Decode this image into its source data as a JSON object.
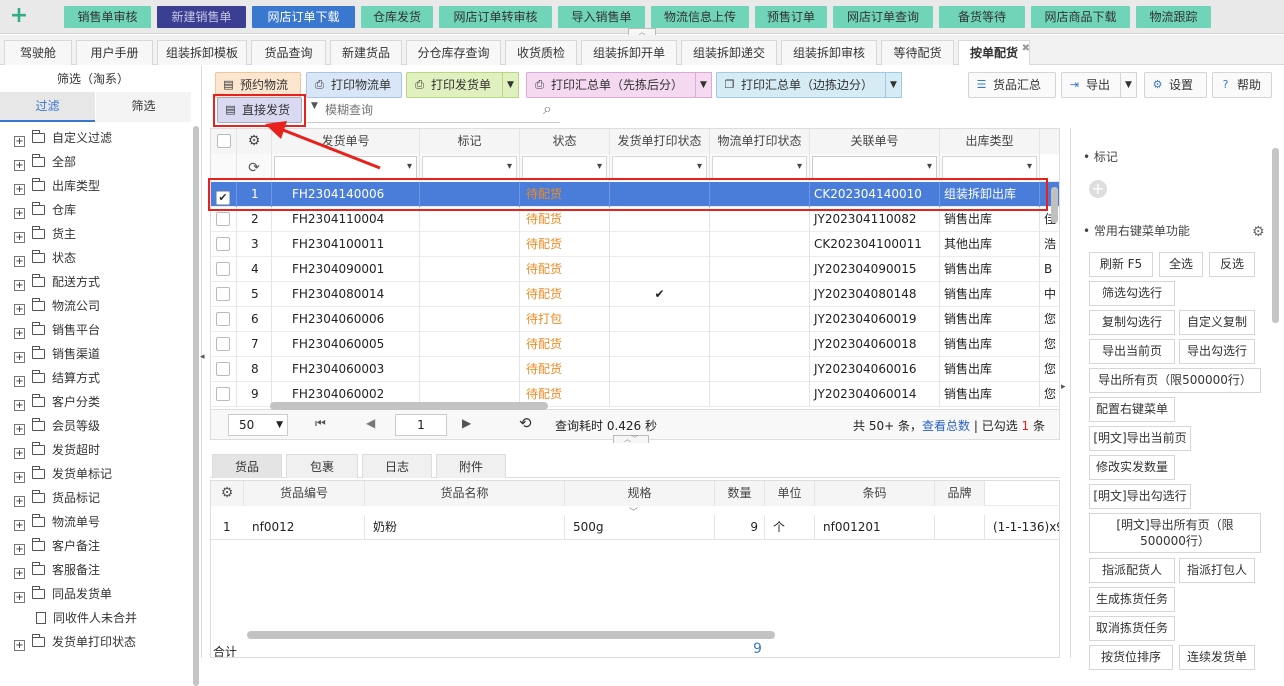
{
  "top_modules": [
    {
      "label": "销售单审核",
      "state": "normal"
    },
    {
      "label": "新建销售单",
      "state": "active"
    },
    {
      "label": "网店订单下载",
      "state": "current"
    },
    {
      "label": "仓库发货",
      "state": "normal"
    },
    {
      "label": "网店订单转审核",
      "state": "normal"
    },
    {
      "label": "导入销售单",
      "state": "normal"
    },
    {
      "label": "物流信息上传",
      "state": "normal"
    },
    {
      "label": "预售订单",
      "state": "normal"
    },
    {
      "label": "网店订单查询",
      "state": "normal"
    },
    {
      "label": "备货等待",
      "state": "normal"
    },
    {
      "label": "网店商品下载",
      "state": "normal"
    },
    {
      "label": "物流跟踪",
      "state": "normal"
    }
  ],
  "tabs": [
    "驾驶舱",
    "用户手册",
    "组装拆卸模板",
    "货品查询",
    "新建货品",
    "分仓库存查询",
    "收货质检",
    "组装拆卸开单",
    "组装拆卸递交",
    "组装拆卸审核",
    "等待配货",
    "按单配货"
  ],
  "sidebar": {
    "title": "筛选（淘系）",
    "tab_filter": "过滤",
    "tab_screen": "筛选",
    "items": [
      "自定义过滤",
      "全部",
      "出库类型",
      "仓库",
      "货主",
      "状态",
      "配送方式",
      "物流公司",
      "销售平台",
      "销售渠道",
      "结算方式",
      "客户分类",
      "会员等级",
      "发货超时",
      "发货单标记",
      "货品标记",
      "物流单号",
      "客户备注",
      "客服备注",
      "同品发货单",
      "同收件人未合并",
      "发货单打印状态"
    ]
  },
  "toolbar": {
    "reserve_logistics": "预约物流",
    "print_logistics": "打印物流单",
    "print_delivery": "打印发货单",
    "print_summary_pick_first": "打印汇总单（先拣后分）",
    "print_summary_pick_while": "打印汇总单（边拣边分）",
    "direct_ship": "直接发货",
    "goods_summary": "货品汇总",
    "export": "导出",
    "settings": "设置",
    "help": "帮助",
    "search_placeholder": "模糊查询"
  },
  "main_table": {
    "columns": [
      "发货单号",
      "标记",
      "状态",
      "发货单打印状态",
      "物流单打印状态",
      "关联单号",
      "出库类型"
    ],
    "rows": [
      {
        "no": "1",
        "order": "FH2304140006",
        "mark": "",
        "status": "待配货",
        "print": "",
        "lprint": "",
        "ref": "CK202304140010",
        "type": "组装拆卸出库",
        "extra": "",
        "selected": true
      },
      {
        "no": "2",
        "order": "FH2304110004",
        "mark": "",
        "status": "待配货",
        "print": "",
        "lprint": "",
        "ref": "JY202304110082",
        "type": "销售出库",
        "extra": "佳",
        "selected": false
      },
      {
        "no": "3",
        "order": "FH2304100011",
        "mark": "",
        "status": "待配货",
        "print": "",
        "lprint": "",
        "ref": "CK202304100011",
        "type": "其他出库",
        "extra": "浩",
        "selected": false
      },
      {
        "no": "4",
        "order": "FH2304090001",
        "mark": "",
        "status": "待配货",
        "print": "",
        "lprint": "",
        "ref": "JY202304090015",
        "type": "销售出库",
        "extra": "B",
        "selected": false
      },
      {
        "no": "5",
        "order": "FH2304080014",
        "mark": "",
        "status": "待配货",
        "print": "✔",
        "lprint": "",
        "ref": "JY202304080148",
        "type": "销售出库",
        "extra": "中",
        "selected": false
      },
      {
        "no": "6",
        "order": "FH2304060006",
        "mark": "",
        "status": "待打包",
        "print": "",
        "lprint": "",
        "ref": "JY202304060019",
        "type": "销售出库",
        "extra": "您",
        "selected": false
      },
      {
        "no": "7",
        "order": "FH2304060005",
        "mark": "",
        "status": "待配货",
        "print": "",
        "lprint": "",
        "ref": "JY202304060018",
        "type": "销售出库",
        "extra": "您",
        "selected": false
      },
      {
        "no": "8",
        "order": "FH2304060003",
        "mark": "",
        "status": "待配货",
        "print": "",
        "lprint": "",
        "ref": "JY202304060016",
        "type": "销售出库",
        "extra": "您",
        "selected": false
      },
      {
        "no": "9",
        "order": "FH2304060002",
        "mark": "",
        "status": "待配货",
        "print": "",
        "lprint": "",
        "ref": "JY202304060014",
        "type": "销售出库",
        "extra": "您",
        "selected": false
      }
    ]
  },
  "pager": {
    "page_size": "50",
    "page": "1",
    "query_time": "查询耗时 0.426 秒",
    "total_prefix": "共 50+ 条，",
    "view_total": "查看总数",
    "sep": " | 已勾选 ",
    "checked": "1",
    "unit": " 条"
  },
  "bottom_tabs": [
    "货品",
    "包裹",
    "日志",
    "附件"
  ],
  "bottom_table": {
    "columns": [
      "货品编号",
      "货品名称",
      "规格",
      "数量",
      "单位",
      "条码",
      "品牌"
    ],
    "rows": [
      {
        "no": "1",
        "code": "nf0012",
        "name": "奶粉",
        "spec": "500g",
        "qty": "9",
        "unit": "个",
        "barcode": "nf001201",
        "brand": "",
        "extra": "(1-1-136)x9"
      }
    ],
    "total_label": "合计",
    "total_qty": "9"
  },
  "right_panel": {
    "mark_title": "标记",
    "menu_title": "常用右键菜单功能",
    "buttons": [
      "刷新 F5",
      "全选",
      "反选",
      "筛选勾选行",
      "复制勾选行",
      "自定义复制",
      "导出当前页",
      "导出勾选行",
      "导出所有页（限500000行）",
      "配置右键菜单",
      "[明文]导出当前页",
      "修改实发数量",
      "[明文]导出勾选行",
      "[明文]导出所有页（限500000行）",
      "指派配货人",
      "指派打包人",
      "生成拣货任务",
      "取消拣货任务",
      "按货位排序",
      "连续发货单"
    ]
  }
}
